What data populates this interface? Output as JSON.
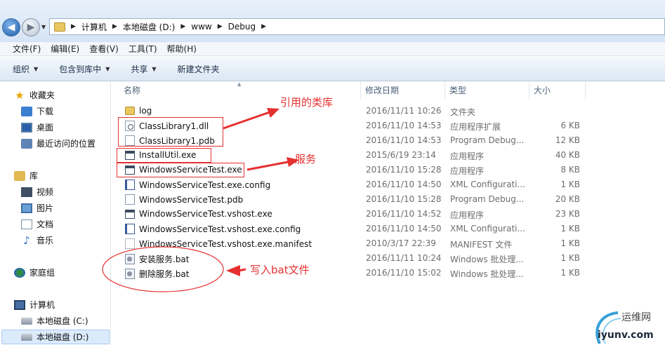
{
  "address_bar": {
    "crumbs": [
      "计算机",
      "本地磁盘 (D:)",
      "www",
      "Debug"
    ]
  },
  "menu": [
    "文件(F)",
    "编辑(E)",
    "查看(V)",
    "工具(T)",
    "帮助(H)"
  ],
  "toolbar": {
    "organize": "组织",
    "include_in_library": "包含到库中",
    "share": "共享",
    "new_folder": "新建文件夹"
  },
  "sidebar": {
    "favorites": "收藏夹",
    "downloads": "下载",
    "desktop": "桌面",
    "recent": "最近访问的位置",
    "libraries": "库",
    "videos": "视频",
    "pictures": "图片",
    "documents": "文档",
    "music": "音乐",
    "homegroup": "家庭组",
    "computer": "计算机",
    "drive_c": "本地磁盘 (C:)",
    "drive_d": "本地磁盘 (D:)"
  },
  "columns": {
    "name": "名称",
    "date": "修改日期",
    "type": "类型",
    "size": "大小"
  },
  "files": [
    {
      "name": "log",
      "date": "2016/11/11 10:26",
      "type": "文件夹",
      "size": "",
      "icon": "folder-icon"
    },
    {
      "name": "ClassLibrary1.dll",
      "date": "2016/11/10 14:53",
      "type": "应用程序扩展",
      "size": "6 KB",
      "icon": "dll-icon"
    },
    {
      "name": "ClassLibrary1.pdb",
      "date": "2016/11/10 14:53",
      "type": "Program Debug...",
      "size": "12 KB",
      "icon": "pdb-icon"
    },
    {
      "name": "InstallUtil.exe",
      "date": "2015/6/19 23:14",
      "type": "应用程序",
      "size": "40 KB",
      "icon": "exe-icon"
    },
    {
      "name": "WindowsServiceTest.exe",
      "date": "2016/11/10 15:28",
      "type": "应用程序",
      "size": "8 KB",
      "icon": "exe-icon"
    },
    {
      "name": "WindowsServiceTest.exe.config",
      "date": "2016/11/10 14:50",
      "type": "XML Configurati...",
      "size": "1 KB",
      "icon": "config-icon"
    },
    {
      "name": "WindowsServiceTest.pdb",
      "date": "2016/11/10 15:28",
      "type": "Program Debug...",
      "size": "20 KB",
      "icon": "pdb-icon"
    },
    {
      "name": "WindowsServiceTest.vshost.exe",
      "date": "2016/11/10 14:52",
      "type": "应用程序",
      "size": "23 KB",
      "icon": "exe-icon"
    },
    {
      "name": "WindowsServiceTest.vshost.exe.config",
      "date": "2016/11/10 14:50",
      "type": "XML Configurati...",
      "size": "1 KB",
      "icon": "config-icon"
    },
    {
      "name": "WindowsServiceTest.vshost.exe.manifest",
      "date": "2010/3/17 22:39",
      "type": "MANIFEST 文件",
      "size": "1 KB",
      "icon": "manifest-icon"
    },
    {
      "name": "安装服务.bat",
      "date": "2016/11/11 10:24",
      "type": "Windows 批处理...",
      "size": "1 KB",
      "icon": "bat-icon"
    },
    {
      "name": "删除服务.bat",
      "date": "2016/11/10 15:02",
      "type": "Windows 批处理...",
      "size": "1 KB",
      "icon": "bat-icon"
    }
  ],
  "annotations": {
    "referenced_library": "引用的类库",
    "service": "服务",
    "write_bat": "写入bat文件"
  },
  "watermark": {
    "line1": "运维网",
    "line2": "iyunv.com"
  },
  "colors": {
    "annotation": "#e53030",
    "selection": "#dcebfc"
  }
}
